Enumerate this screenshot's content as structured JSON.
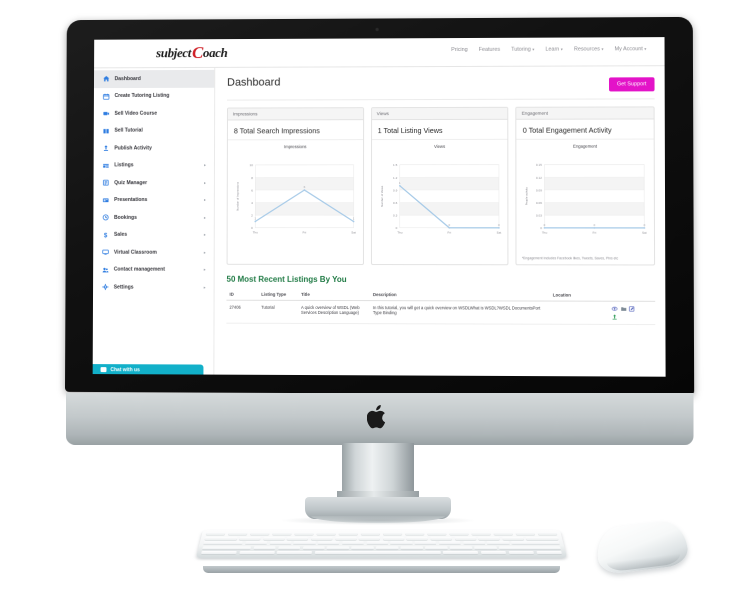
{
  "brand": {
    "name_first": "subject",
    "name_c": "C",
    "name_rest": "oach"
  },
  "topnav": [
    {
      "label": "Pricing",
      "has_caret": false
    },
    {
      "label": "Features",
      "has_caret": false
    },
    {
      "label": "Tutoring",
      "has_caret": true
    },
    {
      "label": "Learn",
      "has_caret": true
    },
    {
      "label": "Resources",
      "has_caret": true
    },
    {
      "label": "My Account",
      "has_caret": true
    }
  ],
  "sidebar": {
    "items": [
      {
        "label": "Dashboard",
        "icon": "home-icon",
        "active": true,
        "arrow": false
      },
      {
        "label": "Create Tutoring Listing",
        "icon": "calendar-icon",
        "active": false,
        "arrow": false
      },
      {
        "label": "Sell Video Course",
        "icon": "video-icon",
        "active": false,
        "arrow": false
      },
      {
        "label": "Sell Tutorial",
        "icon": "book-icon",
        "active": false,
        "arrow": false
      },
      {
        "label": "Publish Activity",
        "icon": "upload-icon",
        "active": false,
        "arrow": false
      },
      {
        "label": "Listings",
        "icon": "list-icon",
        "active": false,
        "arrow": true
      },
      {
        "label": "Quiz Manager",
        "icon": "quiz-icon",
        "active": false,
        "arrow": true
      },
      {
        "label": "Presentations",
        "icon": "slides-icon",
        "active": false,
        "arrow": true
      },
      {
        "label": "Bookings",
        "icon": "clock-icon",
        "active": false,
        "arrow": true
      },
      {
        "label": "Sales",
        "icon": "dollar-icon",
        "active": false,
        "arrow": true
      },
      {
        "label": "Virtual Classroom",
        "icon": "monitor-icon",
        "active": false,
        "arrow": true
      },
      {
        "label": "Contact management",
        "icon": "users-icon",
        "active": false,
        "arrow": true
      },
      {
        "label": "Settings",
        "icon": "gear-icon",
        "active": false,
        "arrow": true
      }
    ],
    "chat_label": "Chat with us"
  },
  "page": {
    "title": "Dashboard",
    "support_button": "Get Support"
  },
  "cards": [
    {
      "head": "Impressions",
      "stat": "8 Total Search Impressions",
      "note": ""
    },
    {
      "head": "Views",
      "stat": "1 Total Listing Views",
      "note": ""
    },
    {
      "head": "Engagement",
      "stat": "0 Total Engagement Activity",
      "note": "*Engagement includes Facebook likes, Tweets, Saves, Pins etc"
    }
  ],
  "chart_data": [
    {
      "type": "line",
      "title": "Impressions",
      "xlabel": "",
      "ylabel": "Number of Impressions",
      "categories": [
        "Thu",
        "Fri",
        "Sat"
      ],
      "values": [
        1,
        6,
        1
      ],
      "point_labels": [
        "1",
        "6",
        "1"
      ],
      "yticks": [
        0,
        2,
        4,
        6,
        8,
        10
      ],
      "ylim": [
        0,
        10
      ],
      "grid": true,
      "legend": "none",
      "series_color": "#a8cbe8"
    },
    {
      "type": "line",
      "title": "Views",
      "xlabel": "",
      "ylabel": "Number of Views",
      "categories": [
        "Thu",
        "Fri",
        "Sat"
      ],
      "values": [
        1,
        0,
        0
      ],
      "point_labels": [
        "1",
        "0",
        "0"
      ],
      "yticks": [
        0,
        0.3,
        0.6,
        0.9,
        1.2,
        1.5
      ],
      "ylim": [
        0,
        1.5
      ],
      "grid": true,
      "legend": "none",
      "series_color": "#a8cbe8"
    },
    {
      "type": "line",
      "title": "Engagement",
      "xlabel": "",
      "ylabel": "People activity",
      "categories": [
        "Thu",
        "Fri",
        "Sat"
      ],
      "values": [
        0,
        0,
        0
      ],
      "point_labels": [
        "0",
        "0",
        "0"
      ],
      "yticks": [
        0,
        0.03,
        0.06,
        0.09,
        0.12,
        0.15
      ],
      "ylim": [
        0,
        0.15
      ],
      "grid": true,
      "legend": "none",
      "series_color": "#a8cbe8"
    }
  ],
  "listings": {
    "title": "50 Most Recent Listings By You",
    "columns": [
      "ID",
      "Listing Type",
      "Title",
      "Description",
      "Location",
      ""
    ],
    "rows": [
      {
        "id": "27406",
        "type": "Tutorial",
        "title": "A quick overview of WSDL (Web Services Description Language)",
        "description": "In this tutorial, you will get a quick overview on WSDLWhat is WSDL?WSDL DocumentsPort Type Binding",
        "location": "",
        "actions": [
          "view-icon",
          "folder-icon",
          "edit-icon",
          "share-icon"
        ]
      }
    ]
  }
}
